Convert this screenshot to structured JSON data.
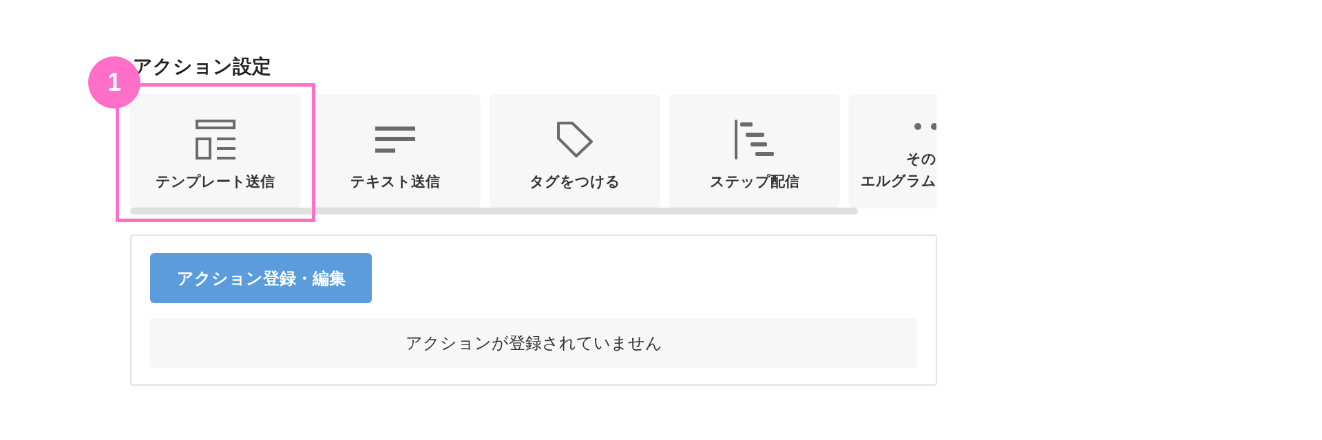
{
  "heading": "アクション設定",
  "action_cards": [
    {
      "label": "テンプレート送信",
      "highlighted": true
    },
    {
      "label": "テキスト送信",
      "highlighted": false
    },
    {
      "label": "タグをつける",
      "highlighted": false
    },
    {
      "label": "ステップ配信",
      "highlighted": false
    },
    {
      "label_lines": [
        "その",
        "エルグラム"
      ],
      "highlighted": false
    }
  ],
  "annotation": {
    "number": "1"
  },
  "actions_panel": {
    "button": "アクション登録・編集",
    "empty_message": "アクションが登録されていません"
  }
}
